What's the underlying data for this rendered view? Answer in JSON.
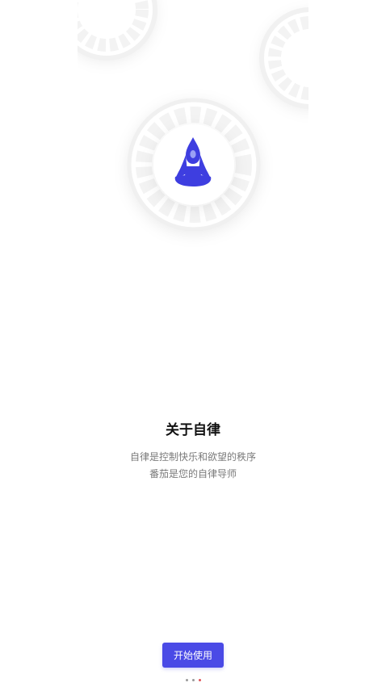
{
  "intro": {
    "title": "关于自律",
    "subtitle_line1": "自律是控制快乐和欲望的秩序",
    "subtitle_line2": "番茄是您的自律导师"
  },
  "actions": {
    "start_label": "开始使用"
  },
  "pager": {
    "count": 3,
    "active_index": 2
  },
  "colors": {
    "accent": "#4a4ae6",
    "icon": "#3e3ee0",
    "dot_active": "#e0555a",
    "dot_inactive": "#9a9a9a",
    "ring": "#f4f4f4"
  },
  "icons": {
    "main": "yoga-meditation-icon"
  }
}
